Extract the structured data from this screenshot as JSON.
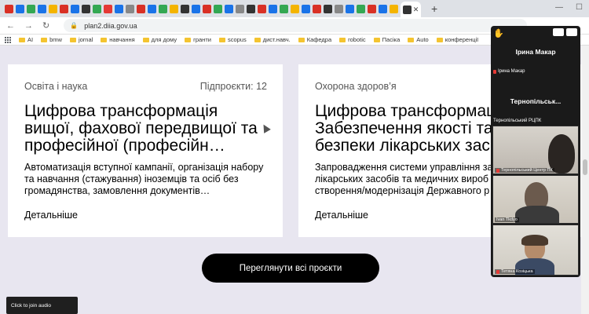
{
  "browser": {
    "url": "plan2.diia.gov.ua",
    "bookmarks": [
      "AI",
      "bmw",
      "jornal",
      "навчання",
      "для дому",
      "гранти",
      "scopus",
      "дист.навч.",
      "Кафедра",
      "robotic",
      "Пасіка",
      "Auto",
      "конференції"
    ],
    "favicon_colors": [
      "#d93025",
      "#1a73e8",
      "#34a853",
      "#1a73e8",
      "#f4b400",
      "#d93025",
      "#1a73e8",
      "#333333",
      "#34a853",
      "#e53935",
      "#1a73e8",
      "#888888",
      "#d93025",
      "#1a73e8",
      "#34a853",
      "#f4b400",
      "#333333",
      "#1a73e8",
      "#d93025",
      "#34a853",
      "#1a73e8",
      "#888888",
      "#333333",
      "#d93025",
      "#1a73e8",
      "#34a853",
      "#f4b400",
      "#1a73e8",
      "#d93025",
      "#333333",
      "#888888",
      "#1a73e8",
      "#34a853",
      "#d93025",
      "#1a73e8",
      "#f4b400",
      "#333333",
      "#1a73e8",
      "#d93025",
      "#34a853"
    ]
  },
  "cards": [
    {
      "category": "Освіта і наука",
      "projects": "Підпроєкти: 12",
      "title": "Цифрова трансформація вищої, фахової передвищої та професійної (професійн…",
      "desc": "Автоматизація вступної кампанії, організація набору та навчання (стажування) іноземців та осіб без громадянства, замовлення документів…",
      "more": "Детальніше"
    },
    {
      "category": "Охорона здоров’я",
      "projects": "",
      "title": "Цифрова трансформац\nЗабезпечення якості та\nбезпеки лікарських зас",
      "desc": "Запровадження системи управління за\nлікарських засобів та медичних вироб\nстворення/модернізація Державного р",
      "more": "Детальніше"
    }
  ],
  "view_all_button": "Переглянути всі проєкти",
  "audio_toast": "Click to join audio",
  "zoom": {
    "host_name": "Ірина Макар",
    "host_label": "Ірина Макар",
    "group_name": "Тернопільськ...",
    "group_label": "Тернопільський РЦПК",
    "participants": [
      {
        "label": "Тернопільський Центр ПК"
      },
      {
        "label": "Ivan Tkdyo"
      },
      {
        "label": "Тетяна Козіцька"
      }
    ]
  }
}
